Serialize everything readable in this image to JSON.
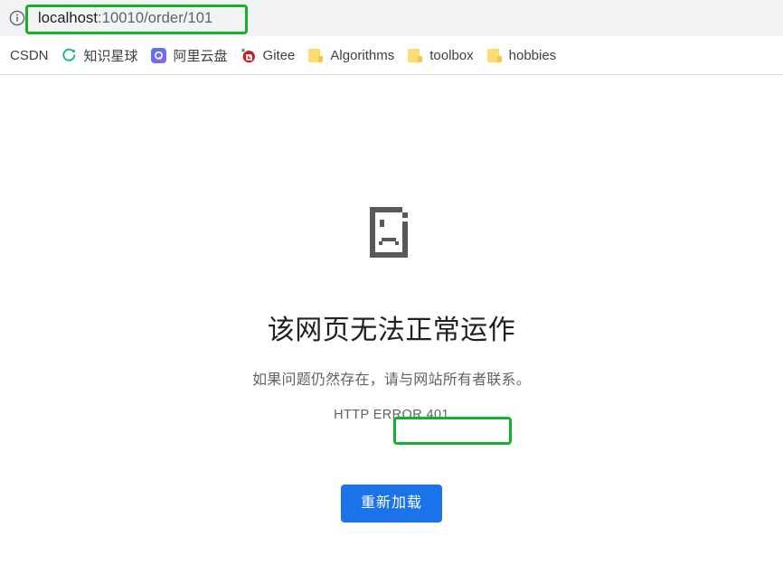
{
  "browser": {
    "site_info_icon": "info-circle-icon",
    "url": {
      "host": "localhost",
      "rest": ":10010/order/101",
      "full": "localhost:10010/order/101"
    },
    "bookmarks": [
      {
        "label": "CSDN",
        "icon": "none"
      },
      {
        "label": "知识星球",
        "icon": "zsxq-circle-icon"
      },
      {
        "label": "阿里云盘",
        "icon": "aliyundrive-icon"
      },
      {
        "label": "Gitee",
        "icon": "gitee-icon"
      },
      {
        "label": "Algorithms",
        "icon": "folder-icon"
      },
      {
        "label": "toolbox",
        "icon": "folder-icon"
      },
      {
        "label": "hobbies",
        "icon": "folder-icon"
      }
    ]
  },
  "error_page": {
    "icon": "sad-page-icon",
    "title": "该网页无法正常运作",
    "subtitle": "如果问题仍然存在，请与网站所有者联系。",
    "error_code": "HTTP ERROR 401",
    "reload_button": "重新加载"
  },
  "annotations": {
    "color": "#16b02a",
    "boxes": [
      "url-bar",
      "error-code"
    ]
  },
  "colors": {
    "toolbar_bg": "#f1f3f4",
    "button_blue": "#1a73e8",
    "text_primary": "#202124",
    "text_secondary": "#5f6368"
  }
}
